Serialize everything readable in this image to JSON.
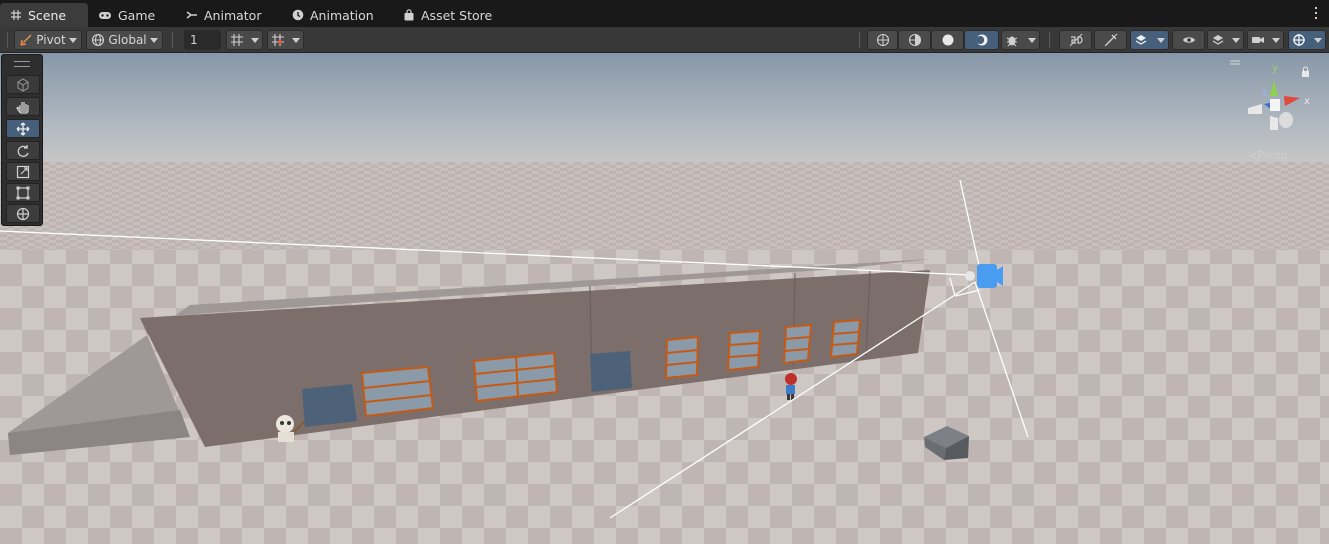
{
  "tabs": [
    {
      "label": "Scene",
      "icon": "grid-icon",
      "active": true
    },
    {
      "label": "Game",
      "icon": "gamepad-icon",
      "active": false
    },
    {
      "label": "Animator",
      "icon": "animator-icon",
      "active": false
    },
    {
      "label": "Animation",
      "icon": "clock-icon",
      "active": false
    },
    {
      "label": "Asset Store",
      "icon": "bag-icon",
      "active": false
    }
  ],
  "toolbar": {
    "pivot_label": "Pivot",
    "global_label": "Global",
    "grid_size_value": "1"
  },
  "gizmo": {
    "persp_label": "Persp",
    "axis_y": "y",
    "axis_x": "x",
    "axis_z": "z"
  },
  "colors": {
    "accent_selected": "#46607c",
    "sky_top": "#8a9cae",
    "ground": "#c9c0bd",
    "building": "#7a6a66",
    "window_frame": "#c45a16"
  }
}
